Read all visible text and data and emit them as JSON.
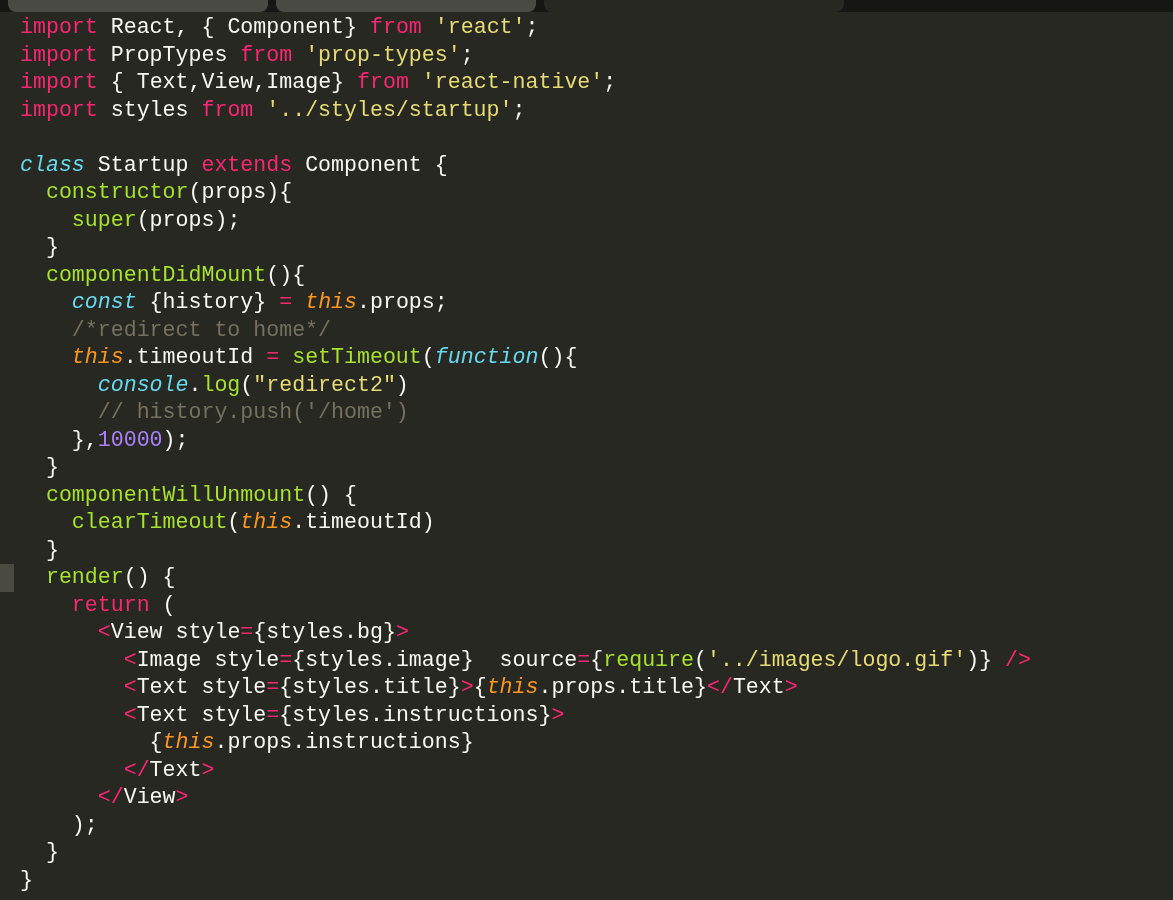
{
  "tabs": [
    {
      "selected": false
    },
    {
      "selected": false
    },
    {
      "selected": true
    }
  ],
  "lines": [
    {
      "current": false,
      "text": "import React, { Component} from 'react';"
    },
    {
      "current": false,
      "text": "import PropTypes from 'prop-types';"
    },
    {
      "current": false,
      "text": "import { Text,View,Image} from 'react-native';"
    },
    {
      "current": false,
      "text": "import styles from '../styles/startup';"
    },
    {
      "current": false
    },
    {
      "current": false,
      "text": "class Startup extends Component {"
    },
    {
      "current": false,
      "text": "  constructor(props){"
    },
    {
      "current": false,
      "text": "    super(props);"
    },
    {
      "current": false,
      "text": "  }"
    },
    {
      "current": false,
      "text": "  componentDidMount(){"
    },
    {
      "current": false,
      "text": "    const {history} = this.props;"
    },
    {
      "current": false,
      "text": "    /*redirect to home*/"
    },
    {
      "current": false,
      "text": "    this.timeoutId = setTimeout(function(){"
    },
    {
      "current": false,
      "text": "      console.log(\"redirect2\")"
    },
    {
      "current": false,
      "text": "      // history.push('/home')"
    },
    {
      "current": false,
      "text": "    },10000);"
    },
    {
      "current": false,
      "text": "  }"
    },
    {
      "current": false,
      "text": "  componentWillUnmount() {"
    },
    {
      "current": false,
      "text": "    clearTimeout(this.timeoutId)"
    },
    {
      "current": false,
      "text": "  }"
    },
    {
      "current": true,
      "text": "  render() {"
    },
    {
      "current": false,
      "text": "    return ("
    },
    {
      "current": false,
      "text": "      <View style={styles.bg}>"
    },
    {
      "current": false,
      "text": "        <Image style={styles.image}  source={require('../images/logo.gif')} />"
    },
    {
      "current": false,
      "text": "        <Text style={styles.title}>{this.props.title}</Text>"
    },
    {
      "current": false,
      "text": "        <Text style={styles.instructions}>"
    },
    {
      "current": false,
      "text": "          {this.props.instructions}"
    },
    {
      "current": false,
      "text": "        </Text>"
    },
    {
      "current": false,
      "text": "      </View>"
    },
    {
      "current": false,
      "text": "    );"
    },
    {
      "current": false,
      "text": "  }"
    },
    {
      "current": false,
      "text": "}"
    }
  ]
}
